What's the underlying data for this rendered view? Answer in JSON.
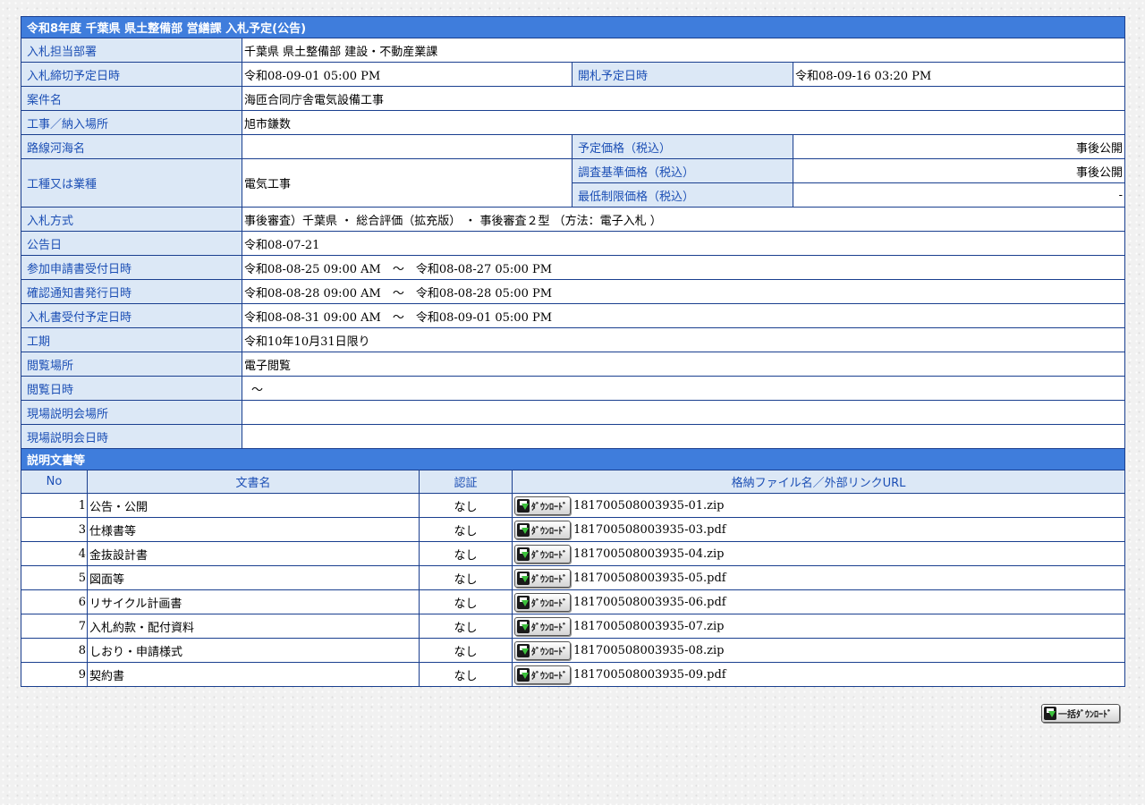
{
  "info": {
    "header": "令和8年度 千葉県 県土整備部 営繕課 入札予定(公告)",
    "dept_label": "入札担当部署",
    "dept_value": "千葉県 県土整備部 建設・不動産業課",
    "deadline_label": "入札締切予定日時",
    "deadline_value": "令和08-09-01 05:00 PM",
    "opening_label": "開札予定日時",
    "opening_value": "令和08-09-16 03:20 PM",
    "project_label": "案件名",
    "project_value": "海匝合同庁舎電気設備工事",
    "location_label": "工事／納入場所",
    "location_value": "旭市鎌数",
    "route_label": "路線河海名",
    "route_value": "",
    "planned_price_label": "予定価格（税込）",
    "planned_price_value": "事後公開",
    "category_label": "工種又は業種",
    "category_value": "電気工事",
    "survey_price_label": "調査基準価格（税込）",
    "survey_price_value": "事後公開",
    "min_price_label": "最低制限価格（税込）",
    "min_price_value": "-",
    "method_label": "入札方式",
    "method_value": "事後審査）千葉県 ・ 総合評価（拡充版） ・ 事後審査２型 （方法：電子入札 ）",
    "notice_date_label": "公告日",
    "notice_date_value": "令和08-07-21",
    "application_label": "参加申請書受付日時",
    "application_value": "令和08-08-25 09:00 AM　～　令和08-08-27 05:00 PM",
    "confirm_label": "確認通知書発行日時",
    "confirm_value": "令和08-08-28 09:00 AM　～　令和08-08-28 05:00 PM",
    "bid_receipt_label": "入札書受付予定日時",
    "bid_receipt_value": "令和08-08-31 09:00 AM　～　令和08-09-01 05:00 PM",
    "period_label": "工期",
    "period_value": "令和10年10月31日限り",
    "viewing_place_label": "閲覧場所",
    "viewing_place_value": "電子閲覧",
    "viewing_date_label": "閲覧日時",
    "viewing_date_value": "～",
    "site_place_label": "現場説明会場所",
    "site_place_value": "",
    "site_date_label": "現場説明会日時",
    "site_date_value": ""
  },
  "docs": {
    "header": "説明文書等",
    "col_no": "No",
    "col_name": "文書名",
    "col_auth": "認証",
    "col_file": "格納ファイル名／外部リンクURL",
    "download_label": "ﾀﾞｳﾝﾛｰﾄﾞ",
    "bulk_download_label": "一括ﾀﾞｳﾝﾛｰﾄﾞ",
    "rows": [
      {
        "no": "1",
        "name": "公告・公開",
        "auth": "なし",
        "file": "181700508003935-01.zip"
      },
      {
        "no": "3",
        "name": "仕様書等",
        "auth": "なし",
        "file": "181700508003935-03.pdf"
      },
      {
        "no": "4",
        "name": "金抜設計書",
        "auth": "なし",
        "file": "181700508003935-04.zip"
      },
      {
        "no": "5",
        "name": "図面等",
        "auth": "なし",
        "file": "181700508003935-05.pdf"
      },
      {
        "no": "6",
        "name": "リサイクル計画書",
        "auth": "なし",
        "file": "181700508003935-06.pdf"
      },
      {
        "no": "7",
        "name": "入札約款・配付資料",
        "auth": "なし",
        "file": "181700508003935-07.zip"
      },
      {
        "no": "8",
        "name": "しおり・申請様式",
        "auth": "なし",
        "file": "181700508003935-08.zip"
      },
      {
        "no": "9",
        "name": "契約書",
        "auth": "なし",
        "file": "181700508003935-09.pdf"
      }
    ]
  }
}
